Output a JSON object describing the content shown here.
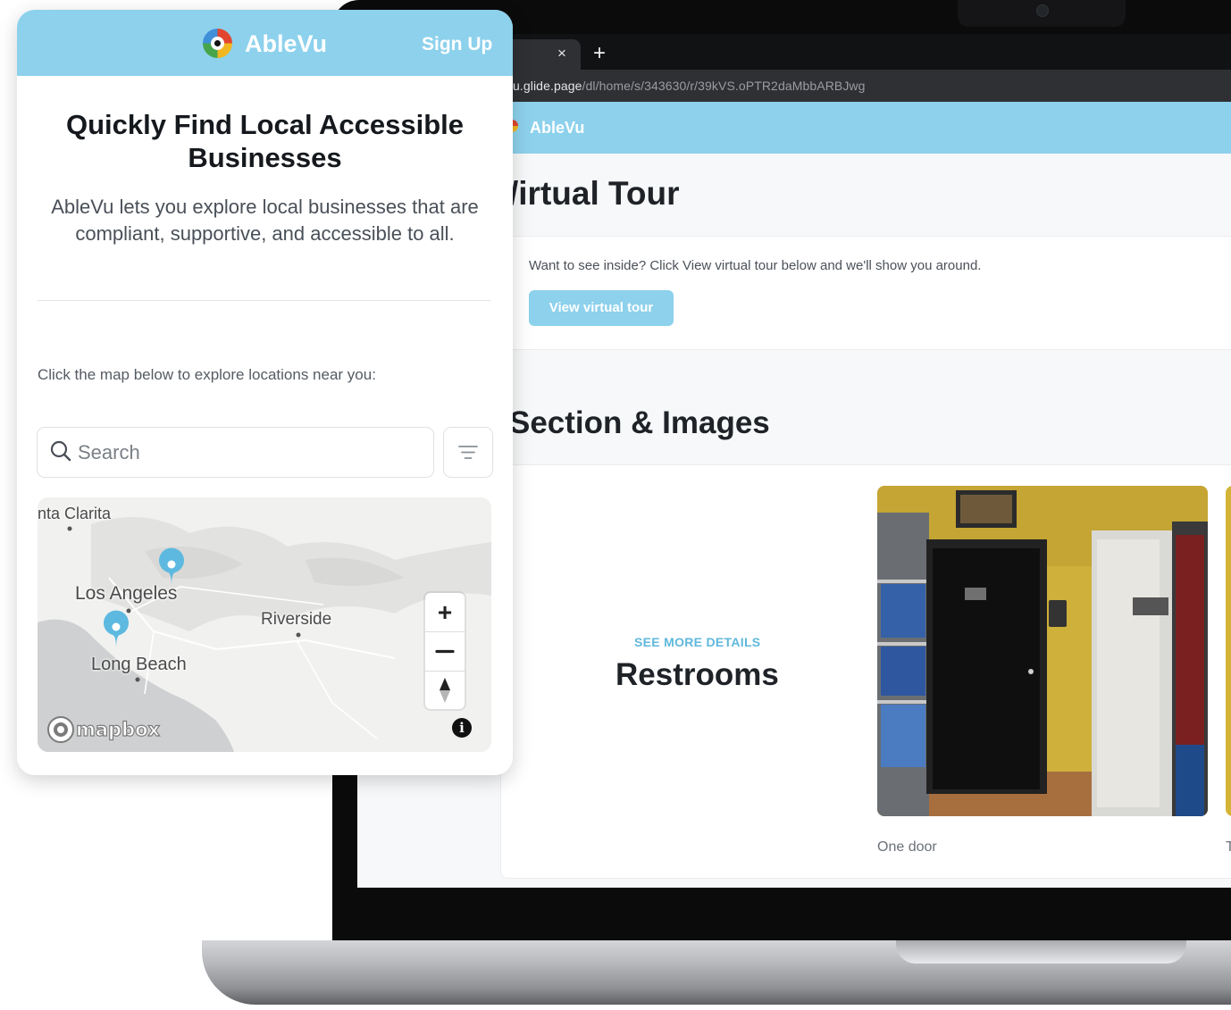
{
  "browser": {
    "tab_close": "×",
    "new_tab": "+",
    "url_domain": "u.glide.page",
    "url_path": "/dl/home/s/343630/r/39kVS.oPTR2daMbbARBJwg"
  },
  "website": {
    "brand": "AbleVu",
    "virtual_tour": {
      "title": "/irtual Tour",
      "text": "Want to see inside? Click View virtual tour below and we'll show you around.",
      "button_label": "View virtual tour"
    },
    "section_title": "Section & Images",
    "feature": {
      "eyebrow": "SEE MORE DETAILS",
      "title": "Restrooms",
      "image_caption": "One door",
      "next_caption": "T"
    }
  },
  "card": {
    "brand": "AbleVu",
    "signup_label": "Sign Up",
    "headline": "Quickly Find Local Accessible Businesses",
    "subtitle": "AbleVu lets you explore local businesses that are compliant, supportive, and accessible to all.",
    "map_prompt": "Click the map below to explore locations near you:",
    "search_placeholder": "Search",
    "map": {
      "labels": {
        "santa_clarita": "nta Clarita",
        "los_angeles": "Los Angeles",
        "riverside": "Riverside",
        "long_beach": "Long Beach"
      },
      "zoom_in": "+",
      "info": "i",
      "attribution": "mapbox"
    }
  },
  "colors": {
    "brand_blue": "#8dd1ec",
    "accent_text": "#5fb8dc",
    "marker": "#5db9e0"
  },
  "icons": [
    "search-icon",
    "filter-icon",
    "location-pin-icon",
    "compass-icon",
    "info-icon",
    "close-icon",
    "plus-icon"
  ]
}
